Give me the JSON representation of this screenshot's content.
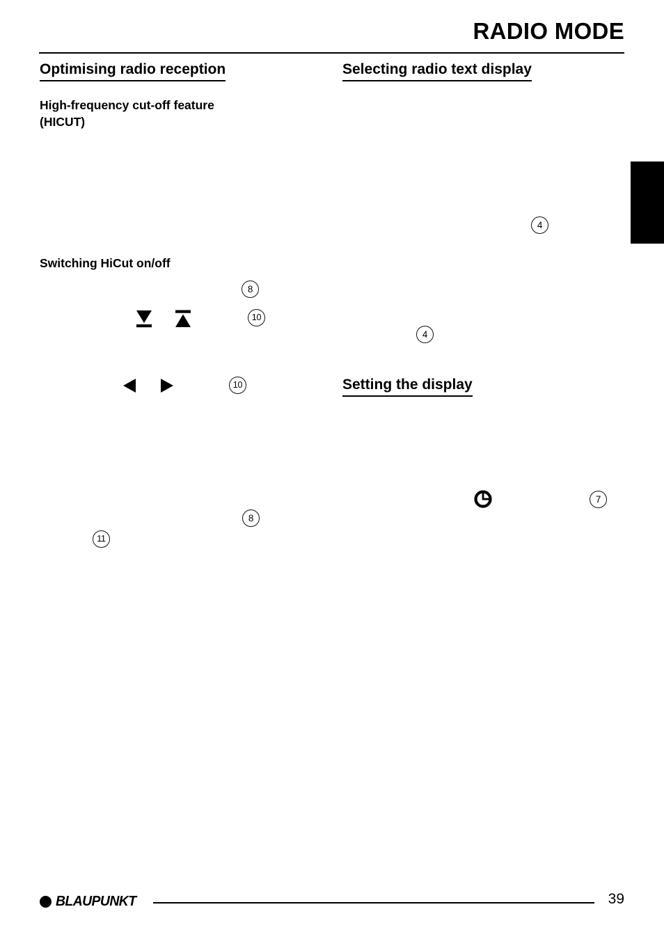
{
  "document": {
    "header_title": "RADIO MODE",
    "page_number": "39",
    "brand": "BLAUPUNKT"
  },
  "left_column": {
    "section_heading": "Optimising radio reception",
    "subheading_line1": "High-frequency cut-off feature",
    "subheading_line2": "(HICUT)",
    "subheading_2": "Switching HiCut on/off"
  },
  "right_column": {
    "section_heading": "Selecting radio text display",
    "section_heading_2": "Setting the display"
  },
  "callouts": {
    "hicut_button_8": "8",
    "hicut_updown_10": "10",
    "hicut_leftright_10": "10",
    "hicut_lower_8": "8",
    "hicut_lower_11": "11",
    "radiotext_upper_4": "4",
    "radiotext_lower_4": "4",
    "display_clock_7": "7"
  },
  "icons": {
    "seek_down": "seek-down-arrow-icon",
    "seek_up": "seek-up-arrow-icon",
    "nav_left": "left-arrow-icon",
    "nav_right": "right-arrow-icon",
    "clock": "clock-icon",
    "logo_dot": "blaupunkt-dot-icon"
  }
}
